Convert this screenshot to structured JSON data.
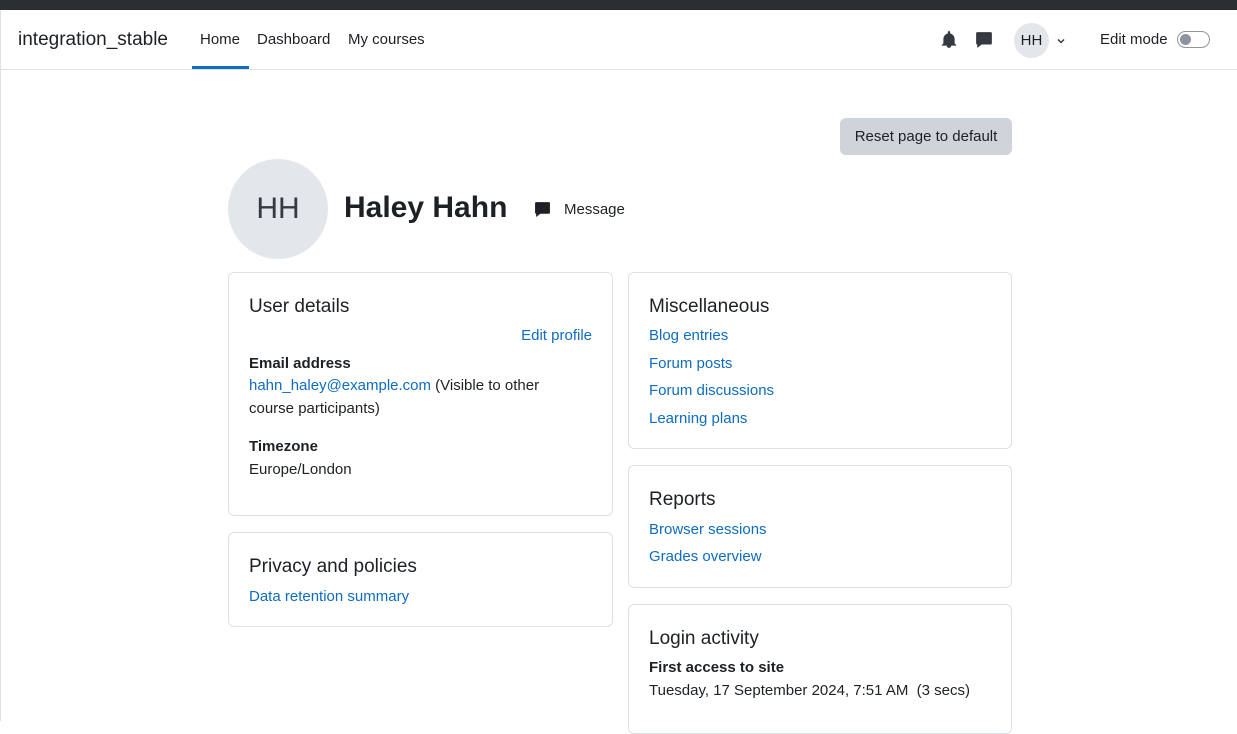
{
  "header": {
    "site_name": "integration_stable",
    "nav": [
      {
        "label": "Home"
      },
      {
        "label": "Dashboard"
      },
      {
        "label": "My courses"
      }
    ],
    "user_initials": "HH",
    "edit_mode_label": "Edit mode",
    "edit_mode_on": false
  },
  "page": {
    "reset_label": "Reset page to default",
    "initials": "HH",
    "full_name": "Haley Hahn",
    "message_label": "Message"
  },
  "user_details": {
    "title": "User details",
    "edit_profile": "Edit profile",
    "email_label": "Email address",
    "email": "hahn_haley@example.com",
    "email_note_1": " (Visible to other",
    "email_note_2": "course participants)",
    "timezone_label": "Timezone",
    "timezone": "Europe/London"
  },
  "privacy": {
    "title": "Privacy and policies",
    "link": "Data retention summary"
  },
  "misc": {
    "title": "Miscellaneous",
    "links": [
      "Blog entries",
      "Forum posts",
      "Forum discussions",
      "Learning plans"
    ]
  },
  "reports": {
    "title": "Reports",
    "links": [
      "Browser sessions",
      "Grades overview"
    ]
  },
  "login": {
    "title": "Login activity",
    "first_access_label": "First access to site",
    "first_access_value": "Tuesday, 17 September 2024, 7:51 AM  (3 secs)"
  }
}
